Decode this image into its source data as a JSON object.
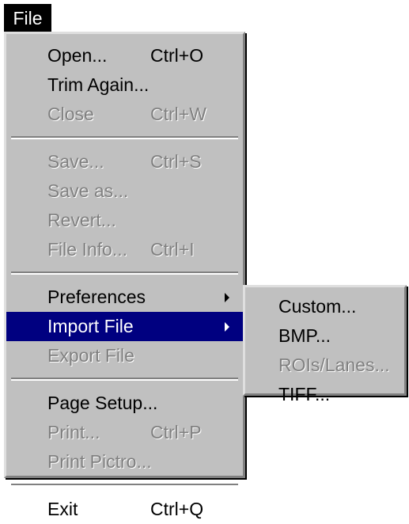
{
  "menubar": {
    "file_label": "File"
  },
  "file_menu": {
    "groups": [
      [
        {
          "label": "Open...",
          "shortcut": "Ctrl+O",
          "state": "enabled"
        },
        {
          "label": "Trim Again...",
          "shortcut": "",
          "state": "enabled"
        },
        {
          "label": "Close",
          "shortcut": "Ctrl+W",
          "state": "disabled"
        }
      ],
      [
        {
          "label": "Save...",
          "shortcut": "Ctrl+S",
          "state": "disabled"
        },
        {
          "label": "Save as...",
          "shortcut": "",
          "state": "disabled"
        },
        {
          "label": "Revert...",
          "shortcut": "",
          "state": "disabled"
        },
        {
          "label": "File Info...",
          "shortcut": "Ctrl+I",
          "state": "disabled"
        }
      ],
      [
        {
          "label": "Preferences",
          "shortcut": "",
          "state": "enabled",
          "submenu": true
        },
        {
          "label": "Import File",
          "shortcut": "",
          "state": "highlighted",
          "submenu": true
        },
        {
          "label": "Export File",
          "shortcut": "",
          "state": "disabled"
        }
      ],
      [
        {
          "label": "Page Setup...",
          "shortcut": "",
          "state": "enabled"
        },
        {
          "label": "Print...",
          "shortcut": "Ctrl+P",
          "state": "disabled"
        },
        {
          "label": "Print Pictro...",
          "shortcut": "",
          "state": "disabled"
        }
      ],
      [
        {
          "label": "Exit",
          "shortcut": "Ctrl+Q",
          "state": "enabled"
        }
      ]
    ]
  },
  "import_submenu": {
    "items": [
      {
        "label": "Custom...",
        "state": "enabled"
      },
      {
        "label": "BMP...",
        "state": "enabled"
      },
      {
        "label": "ROIs/Lanes...",
        "state": "disabled"
      },
      {
        "label": "TIFF...",
        "state": "enabled"
      }
    ]
  },
  "colors": {
    "menu_face": "#c0c0c0",
    "highlight": "#000080",
    "disabled_text": "#808080",
    "menubar_active": "#000000"
  }
}
